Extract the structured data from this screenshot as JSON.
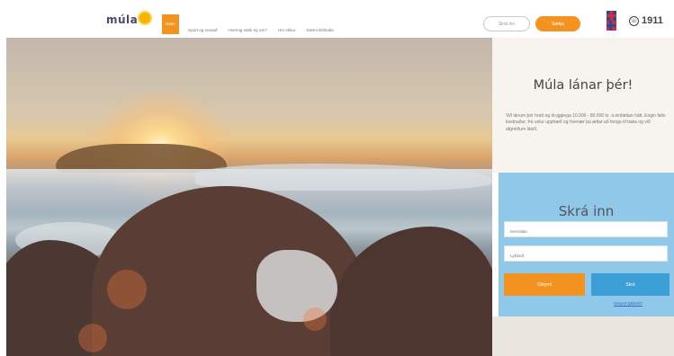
{
  "header": {
    "logo": "múla",
    "nav": [
      "Heim",
      "Spurt og svarað",
      "Hvernig sæki ég um?",
      "Um okkur",
      "Dæmi skilmála"
    ],
    "login_label": "Skrá inn",
    "apply_label": "Sækja",
    "phone": "1911"
  },
  "side": {
    "title": "Múla lánar þér!",
    "description": "Við lánum þér hratt og örugglega 10.000 - 80.000 kr. á einfaldan hátt. Engin falin kostnaður. Þú velur upphæð og hvenær þú ætlar að borga til baka og við afgreiðum lánið."
  },
  "login": {
    "title": "Skrá inn",
    "user_placeholder": "Kennitala",
    "pass_placeholder": "Lykilorð",
    "forgot_label": "Gleymt",
    "register_label": "Skrá",
    "help_link": "Gleymt lykilorð?"
  },
  "colors": {
    "accent": "#f39320",
    "blue": "#3c9fd6",
    "login_bg": "#8fc8e8"
  },
  "icons": [
    "logo-sun-icon",
    "flag-uk-icon",
    "flag-is-icon",
    "phone-icon"
  ]
}
